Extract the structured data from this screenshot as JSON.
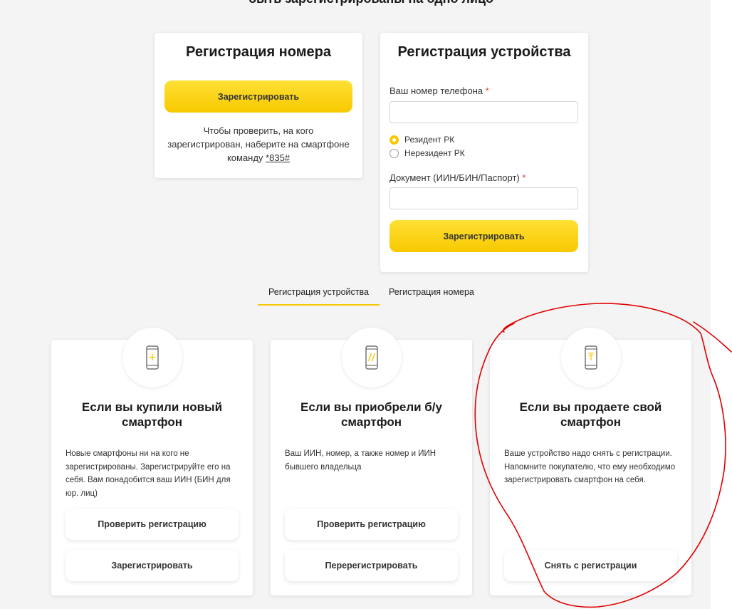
{
  "intro": {
    "title_tail": "быть зарегистрированы на одно лицо"
  },
  "number_card": {
    "title": "Регистрация номера",
    "button": "Зарегистрировать",
    "hint": "Чтобы проверить, на кого зарегистрирован, наберите на смартфоне команду",
    "code": "*835#"
  },
  "device_card": {
    "title": "Регистрация устройства",
    "phone_label": "Ваш номер телефона",
    "required_mark": "*",
    "phone_value": "",
    "residency": [
      {
        "label": "Резидент РК",
        "selected": true
      },
      {
        "label": "Нерезидент РК",
        "selected": false
      }
    ],
    "document_label": "Документ (ИИН/БИН/Паспорт)",
    "document_value": "",
    "button": "Зарегистрировать"
  },
  "tabs": [
    {
      "label": "Регистрация устройства",
      "active": true
    },
    {
      "label": "Регистрация номера",
      "active": false
    }
  ],
  "scenarios": [
    {
      "icon": "phone-add-icon",
      "title": "Если вы купили новый смартфон",
      "text": "Новые смартфоны ни на кого не зарегистрированы. Зарегистрируйте его на себя. Вам понадобится ваш ИИН (БИН для юр. лиц)",
      "buttons": [
        "Проверить регистрацию",
        "Зарегистрировать"
      ]
    },
    {
      "icon": "phone-reregister-icon",
      "title": "Если вы приобрели б/у смартфон",
      "text": "Ваш ИИН, номер, а также номер и ИИН бывшего владельца",
      "buttons": [
        "Проверить регистрацию",
        "Перерегистрировать"
      ]
    },
    {
      "icon": "phone-unregister-icon",
      "title": "Если вы продаете свой смартфон",
      "text": "Ваше устройство надо снять с регистрации. Напомните покупателю, что ему необходимо зарегистрировать смартфон на себя.",
      "buttons": [
        "Снять с регистрации"
      ]
    }
  ],
  "colors": {
    "accent": "#f7c900",
    "page_background": "#f4f4f4",
    "required": "#e53935",
    "annotation": "#e00000"
  }
}
